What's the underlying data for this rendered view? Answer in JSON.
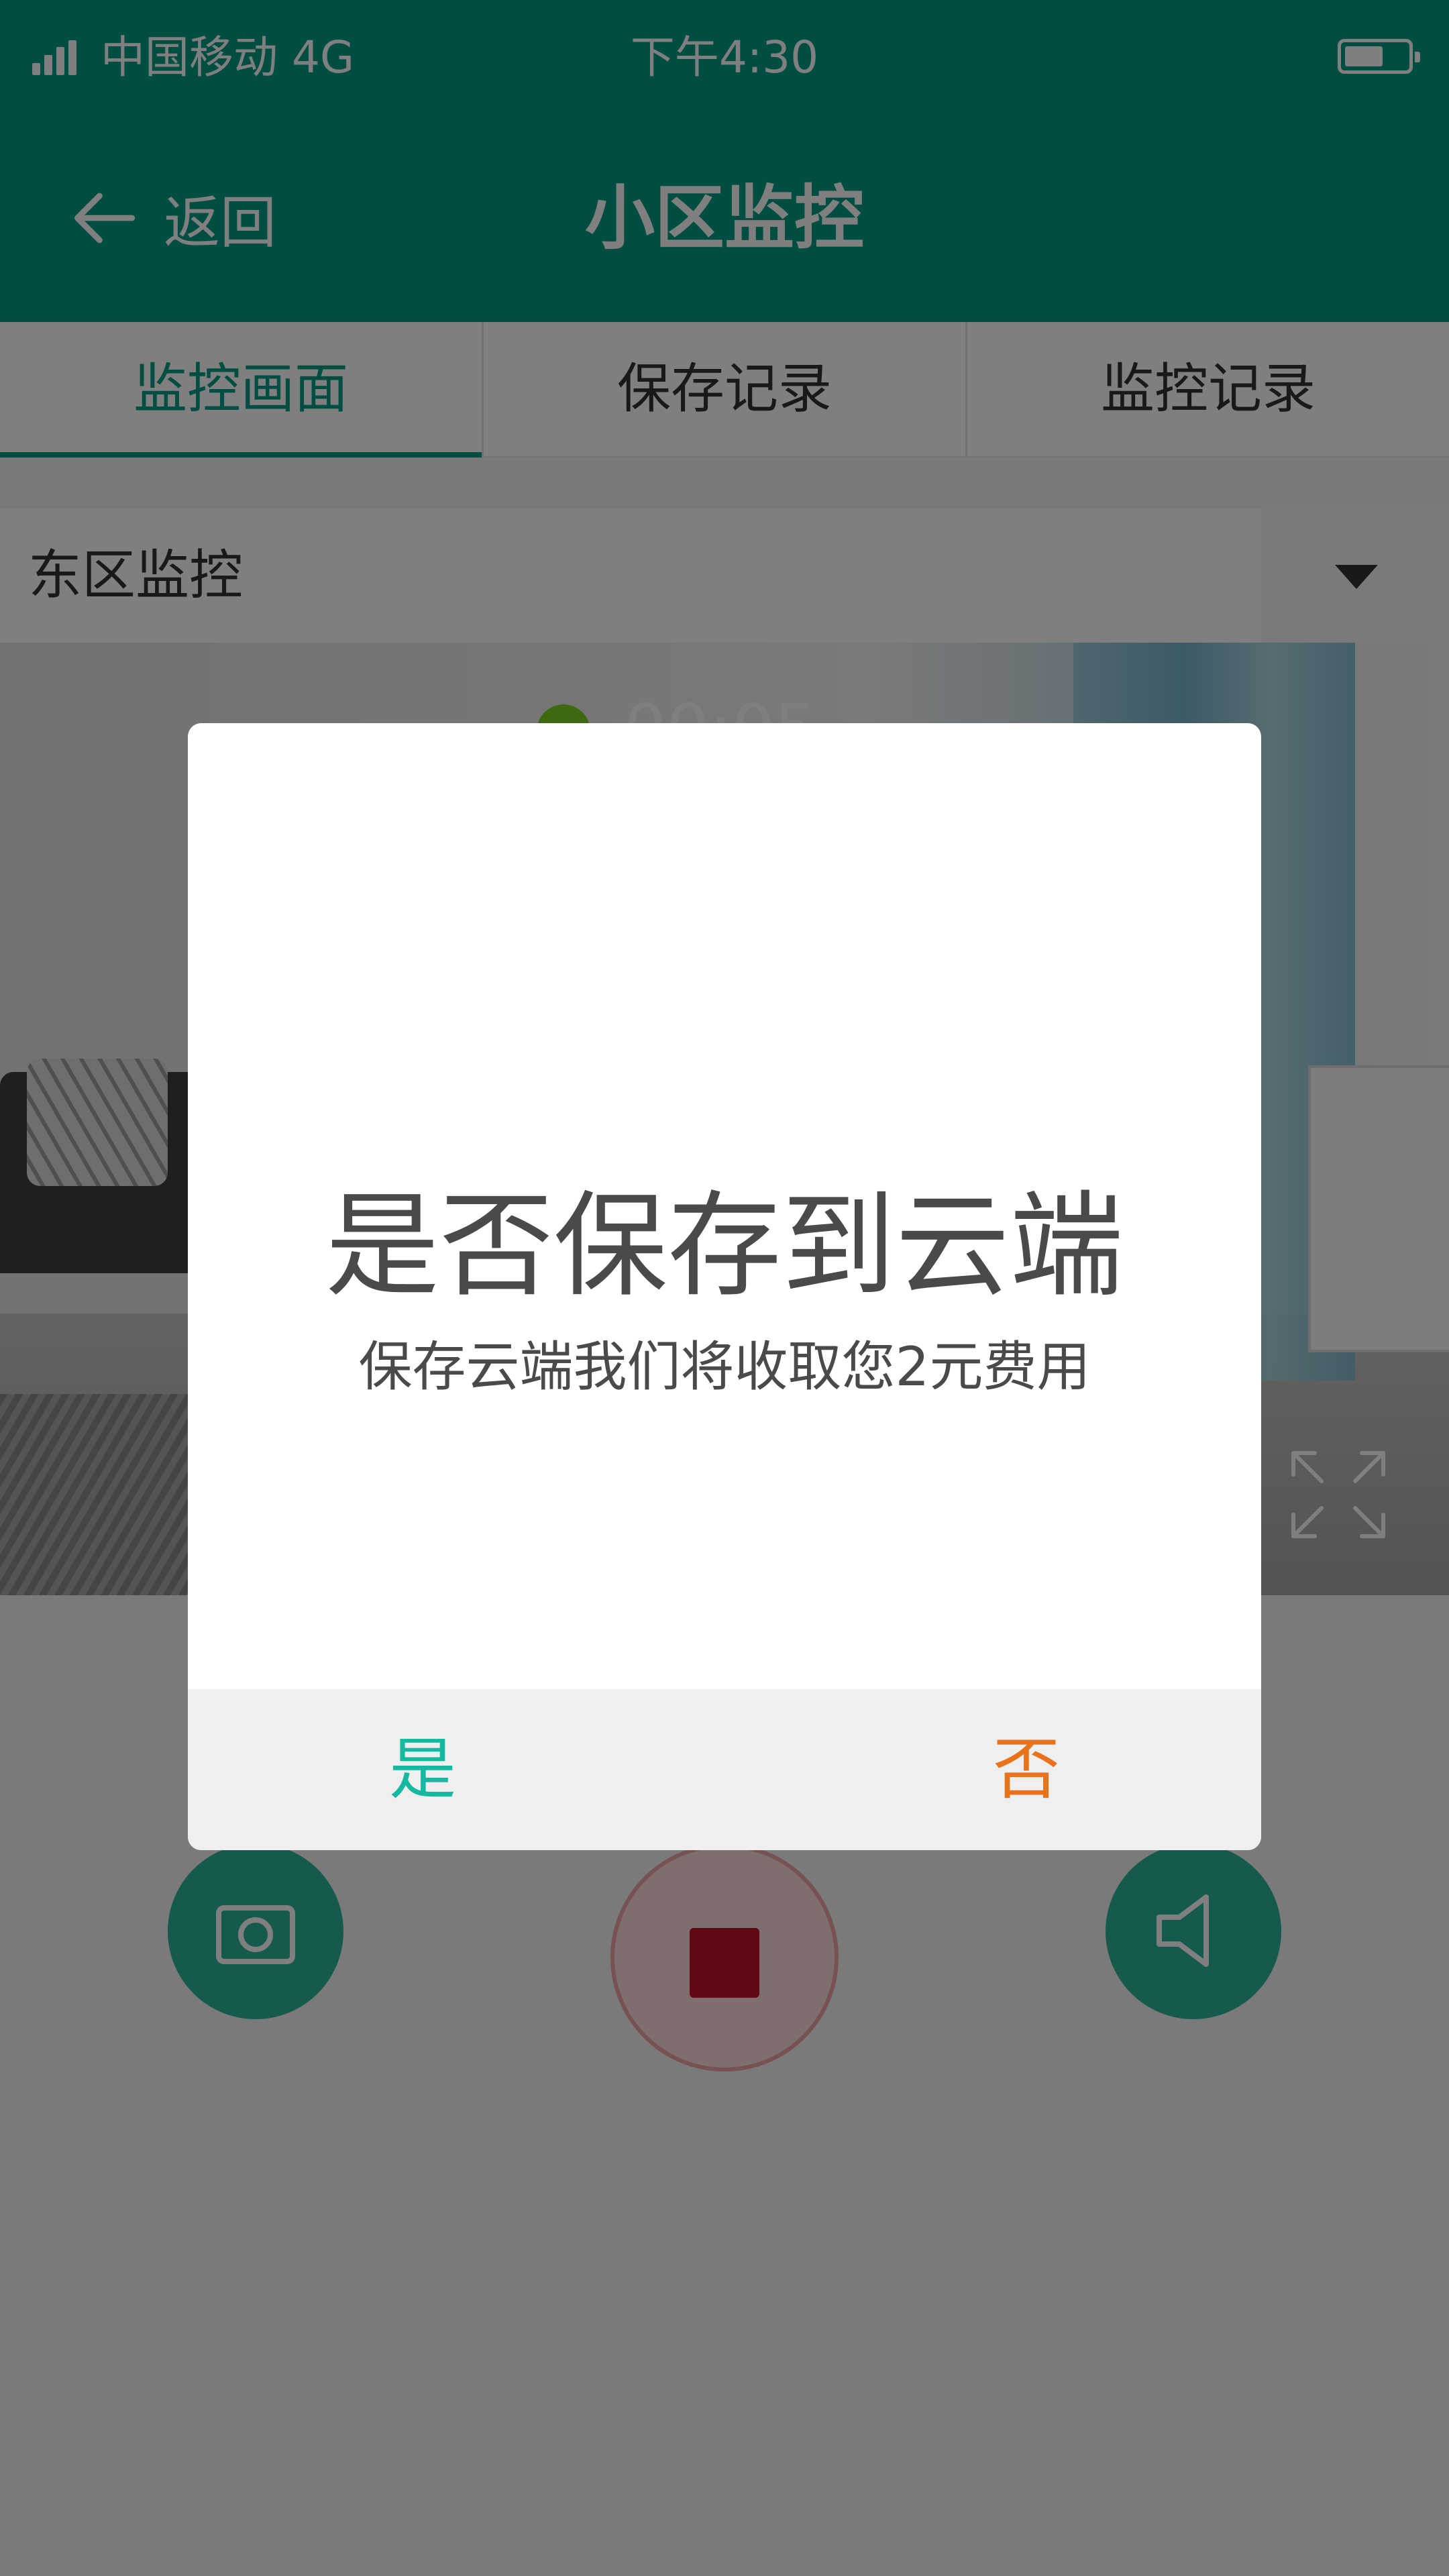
{
  "status_bar": {
    "carrier": "中国移动  4G",
    "time": "下午4:30"
  },
  "nav": {
    "back_label": "返回",
    "title": "小区监控"
  },
  "tabs": [
    {
      "label": "监控画面",
      "active": true
    },
    {
      "label": "保存记录",
      "active": false
    },
    {
      "label": "监控记录",
      "active": false
    }
  ],
  "camera_selector": {
    "selected": "东区监控"
  },
  "video": {
    "recording_time": "00:05"
  },
  "colors": {
    "primary": "#009a83",
    "yes": "#15b8a1",
    "no": "#e8731a",
    "record": "#c0122b"
  },
  "dialog": {
    "title": "是否保存到云端",
    "message": "保存云端我们将收取您2元费用",
    "yes_label": "是",
    "no_label": "否"
  }
}
